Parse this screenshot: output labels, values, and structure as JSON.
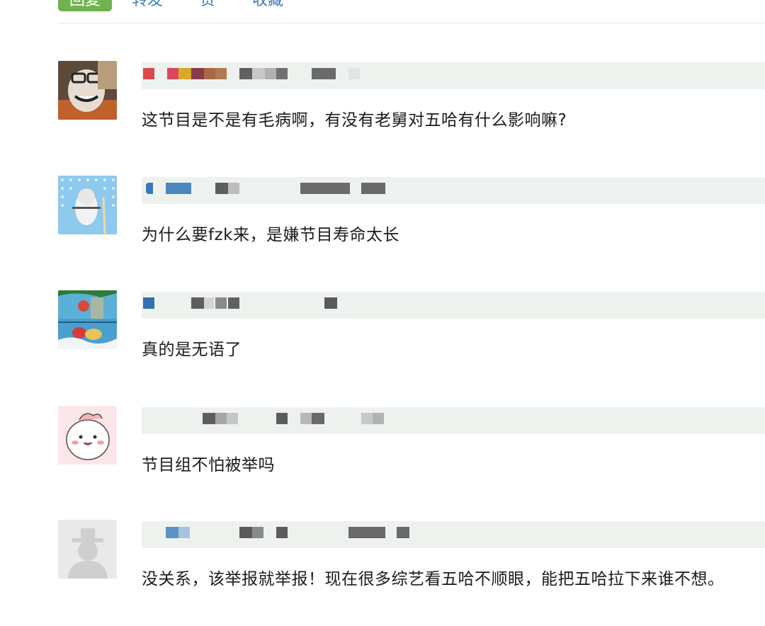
{
  "toolbar": {
    "reply_label": "回复",
    "forward_label": "转发",
    "like_label": "赞",
    "favorite_label": "收藏"
  },
  "comments": [
    {
      "avatar_icon": "avatar-icon",
      "text": "这节目是不是有毛病啊，有没有老舅对五哈有什么影响嘛?"
    },
    {
      "avatar_icon": "avatar-icon",
      "text": "为什么要fzk来，是嫌节目寿命太长"
    },
    {
      "avatar_icon": "avatar-icon",
      "text": "真的是无语了"
    },
    {
      "avatar_icon": "avatar-icon",
      "text": "节目组不怕被举吗"
    },
    {
      "avatar_icon": "default-avatar-icon",
      "text": "没关系，该举报就举报！现在很多综艺看五哈不顺眼，能把五哈拉下来谁不想。"
    }
  ],
  "colors": {
    "accent": "#6fb24f",
    "link": "#3d7ab8",
    "text": "#1b1b1b"
  }
}
